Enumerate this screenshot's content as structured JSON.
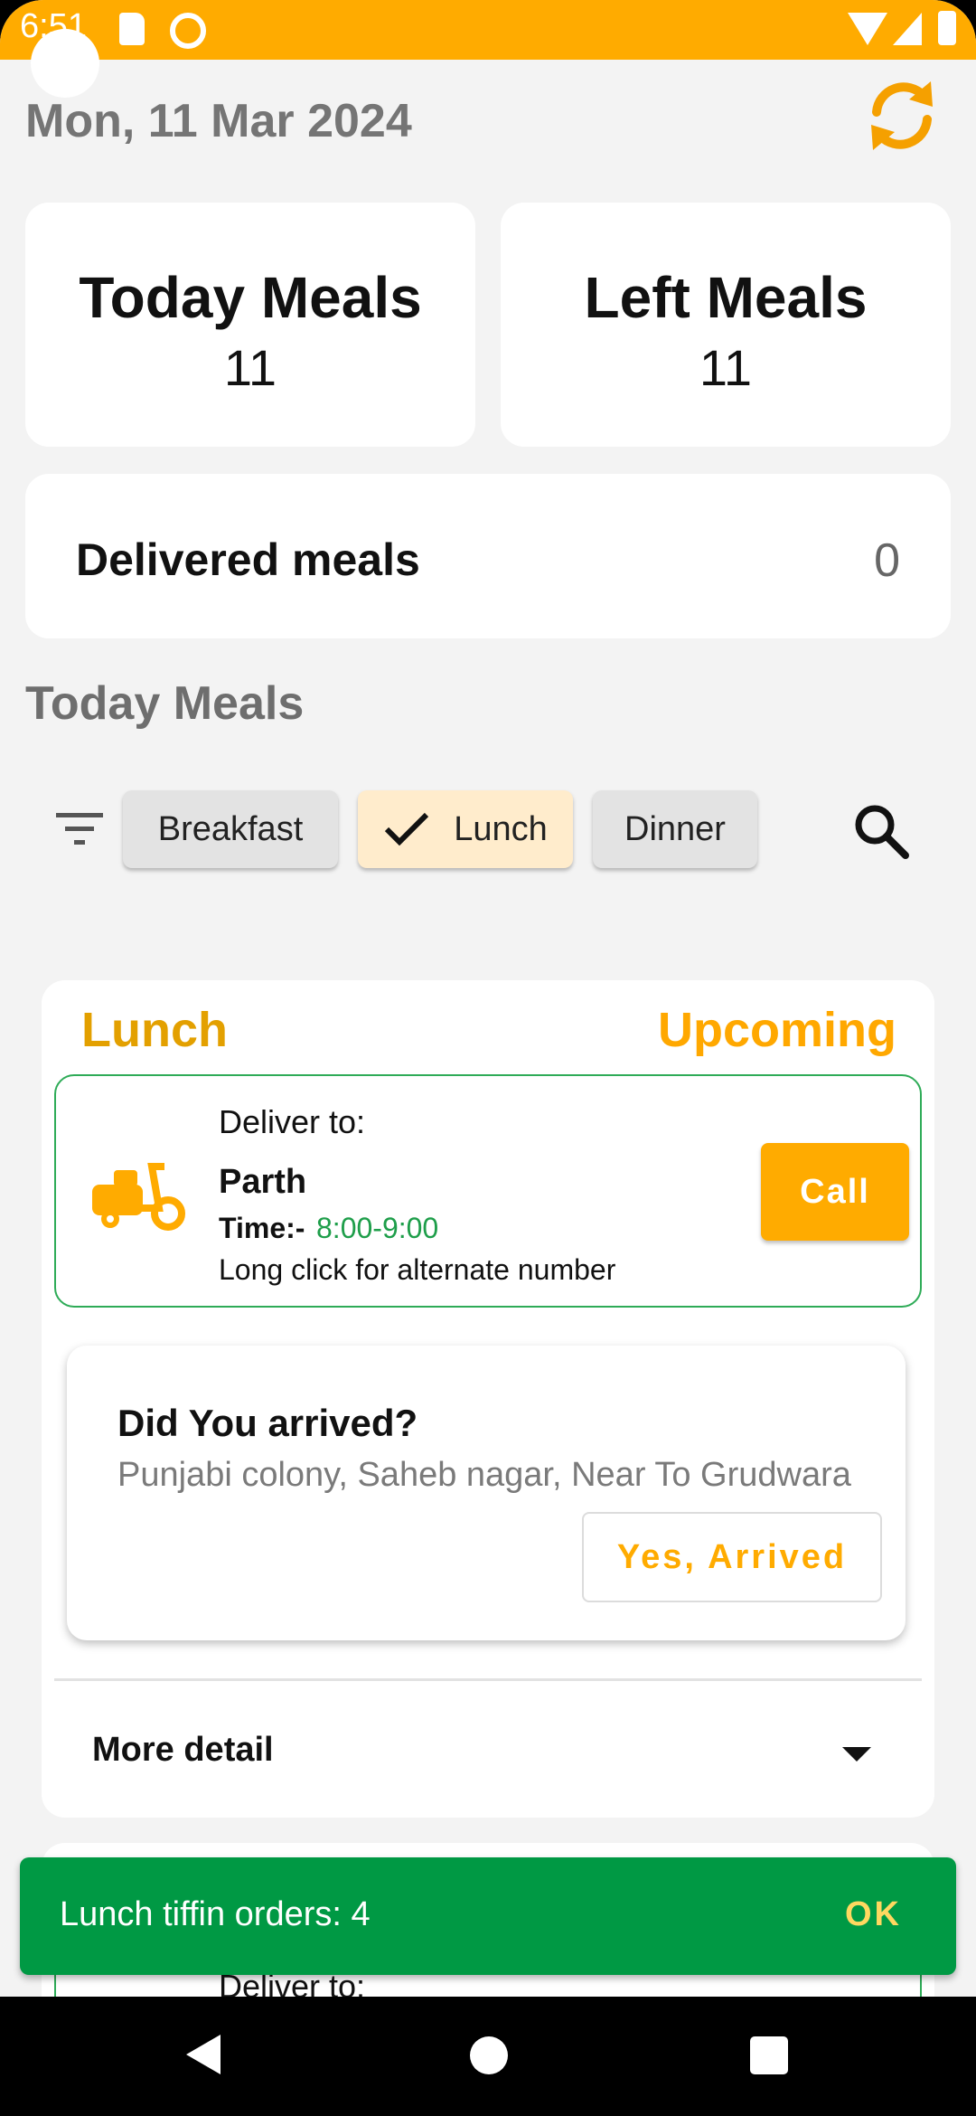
{
  "status_bar": {
    "time": "6:51"
  },
  "header": {
    "date": "Mon, 11 Mar 2024"
  },
  "stats": {
    "today_meals_label": "Today Meals",
    "today_meals_value": "11",
    "left_meals_label": "Left Meals",
    "left_meals_value": "11",
    "delivered_label": "Delivered meals",
    "delivered_value": "0"
  },
  "section": {
    "title": "Today Meals"
  },
  "filters": {
    "chips": [
      {
        "label": "Breakfast",
        "selected": false
      },
      {
        "label": "Lunch",
        "selected": true
      },
      {
        "label": "Dinner",
        "selected": false
      }
    ]
  },
  "meal_card": {
    "meal": "Lunch",
    "status": "Upcoming",
    "deliver_label": "Deliver to:",
    "customer": "Parth",
    "time_label": "Time:-",
    "time_value": "8:00-9:00",
    "alt_hint": "Long click for alternate number",
    "call_label": "Call",
    "arrival": {
      "question": "Did You arrived?",
      "address": "Punjabi colony, Saheb nagar, Near To Grudwara",
      "button": "Yes, Arrived"
    },
    "more_detail": "More detail"
  },
  "next_card": {
    "deliver_label": "Deliver to:"
  },
  "snackbar": {
    "message": "Lunch tiffin orders: 4",
    "action": "OK"
  },
  "colors": {
    "accent": "#ffab00",
    "status_green": "#009944",
    "time_green": "#1e9e4a",
    "background": "#f3f3f3"
  },
  "icons": [
    "refresh-icon",
    "filter-icon",
    "check-icon",
    "search-icon",
    "scooter-icon",
    "chevron-down-icon"
  ]
}
